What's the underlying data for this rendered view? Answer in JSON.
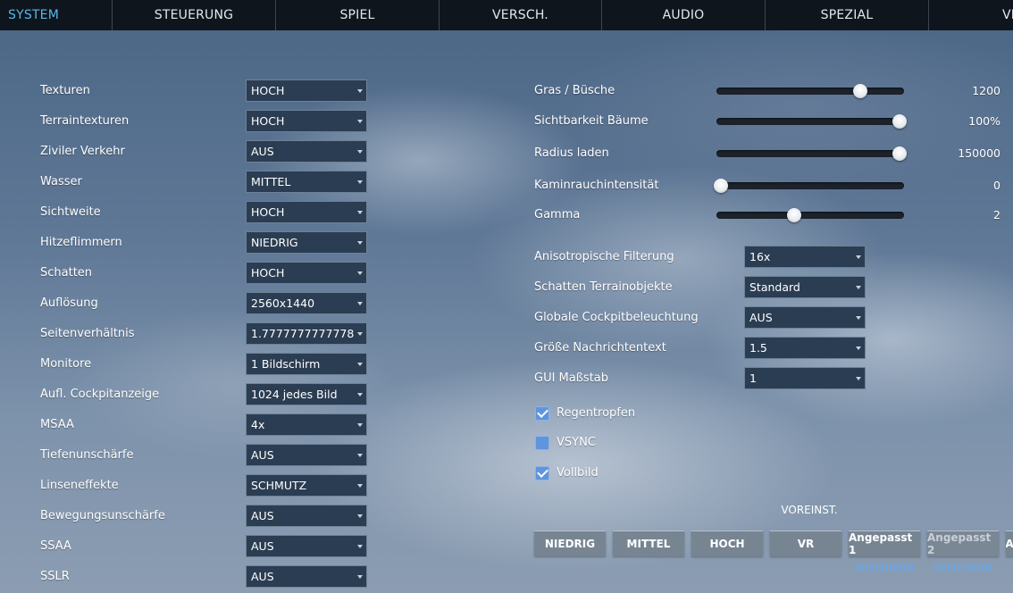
{
  "tabs": [
    "SYSTEM",
    "STEUERUNG",
    "SPIEL",
    "VERSCH.",
    "AUDIO",
    "SPEZIAL",
    "VR"
  ],
  "active_tab": "SYSTEM",
  "left_settings": [
    {
      "label": "Texturen",
      "value": "HOCH"
    },
    {
      "label": "Terraintexturen",
      "value": "HOCH"
    },
    {
      "label": "Ziviler Verkehr",
      "value": "AUS"
    },
    {
      "label": "Wasser",
      "value": "MITTEL"
    },
    {
      "label": "Sichtweite",
      "value": "HOCH"
    },
    {
      "label": "Hitzeflimmern",
      "value": "NIEDRIG"
    },
    {
      "label": "Schatten",
      "value": "HOCH"
    },
    {
      "label": "Auflösung",
      "value": "2560x1440"
    },
    {
      "label": "Seitenverhältnis",
      "value": "1.7777777777778"
    },
    {
      "label": "Monitore",
      "value": "1 Bildschirm"
    },
    {
      "label": "Aufl. Cockpitanzeige",
      "value": "1024 jedes Bild"
    },
    {
      "label": "MSAA",
      "value": "4x"
    },
    {
      "label": "Tiefenunschärfe",
      "value": "AUS"
    },
    {
      "label": "Linseneffekte",
      "value": "SCHMUTZ"
    },
    {
      "label": "Bewegungsunschärfe",
      "value": "AUS"
    },
    {
      "label": "SSAA",
      "value": "AUS"
    },
    {
      "label": "SSLR",
      "value": "AUS"
    }
  ],
  "sliders": [
    {
      "label": "Gras / Büsche",
      "value": "1200",
      "level": 0.78
    },
    {
      "label": "Sichtbarkeit Bäume",
      "value": "100%",
      "level": 1.0
    },
    {
      "label": "Radius laden",
      "value": "150000",
      "level": 1.0
    },
    {
      "label": "Kaminrauchintensität",
      "value": "0",
      "level": 0.0
    },
    {
      "label": "Gamma",
      "value": "2",
      "level": 0.41
    }
  ],
  "right_settings": [
    {
      "label": "Anisotropische Filterung",
      "value": "16x"
    },
    {
      "label": "Schatten Terrainobjekte",
      "value": "Standard"
    },
    {
      "label": "Globale Cockpitbeleuchtung",
      "value": "AUS"
    },
    {
      "label": "Größe Nachrichtentext",
      "value": "1.5"
    },
    {
      "label": "GUI Maßstab",
      "value": "1"
    }
  ],
  "checkboxes": [
    {
      "label": "Regentropfen",
      "checked": true
    },
    {
      "label": "VSYNC",
      "checked": false
    },
    {
      "label": "Vollbild",
      "checked": true
    }
  ],
  "presets": {
    "title": "VOREINST.",
    "buttons": [
      "NIEDRIG",
      "MITTEL",
      "HOCH",
      "VR",
      "Angepasst 1",
      "Angepasst 2",
      "A"
    ],
    "save_labels": [
      "SPEICHERN",
      "SPEICHERN"
    ]
  }
}
